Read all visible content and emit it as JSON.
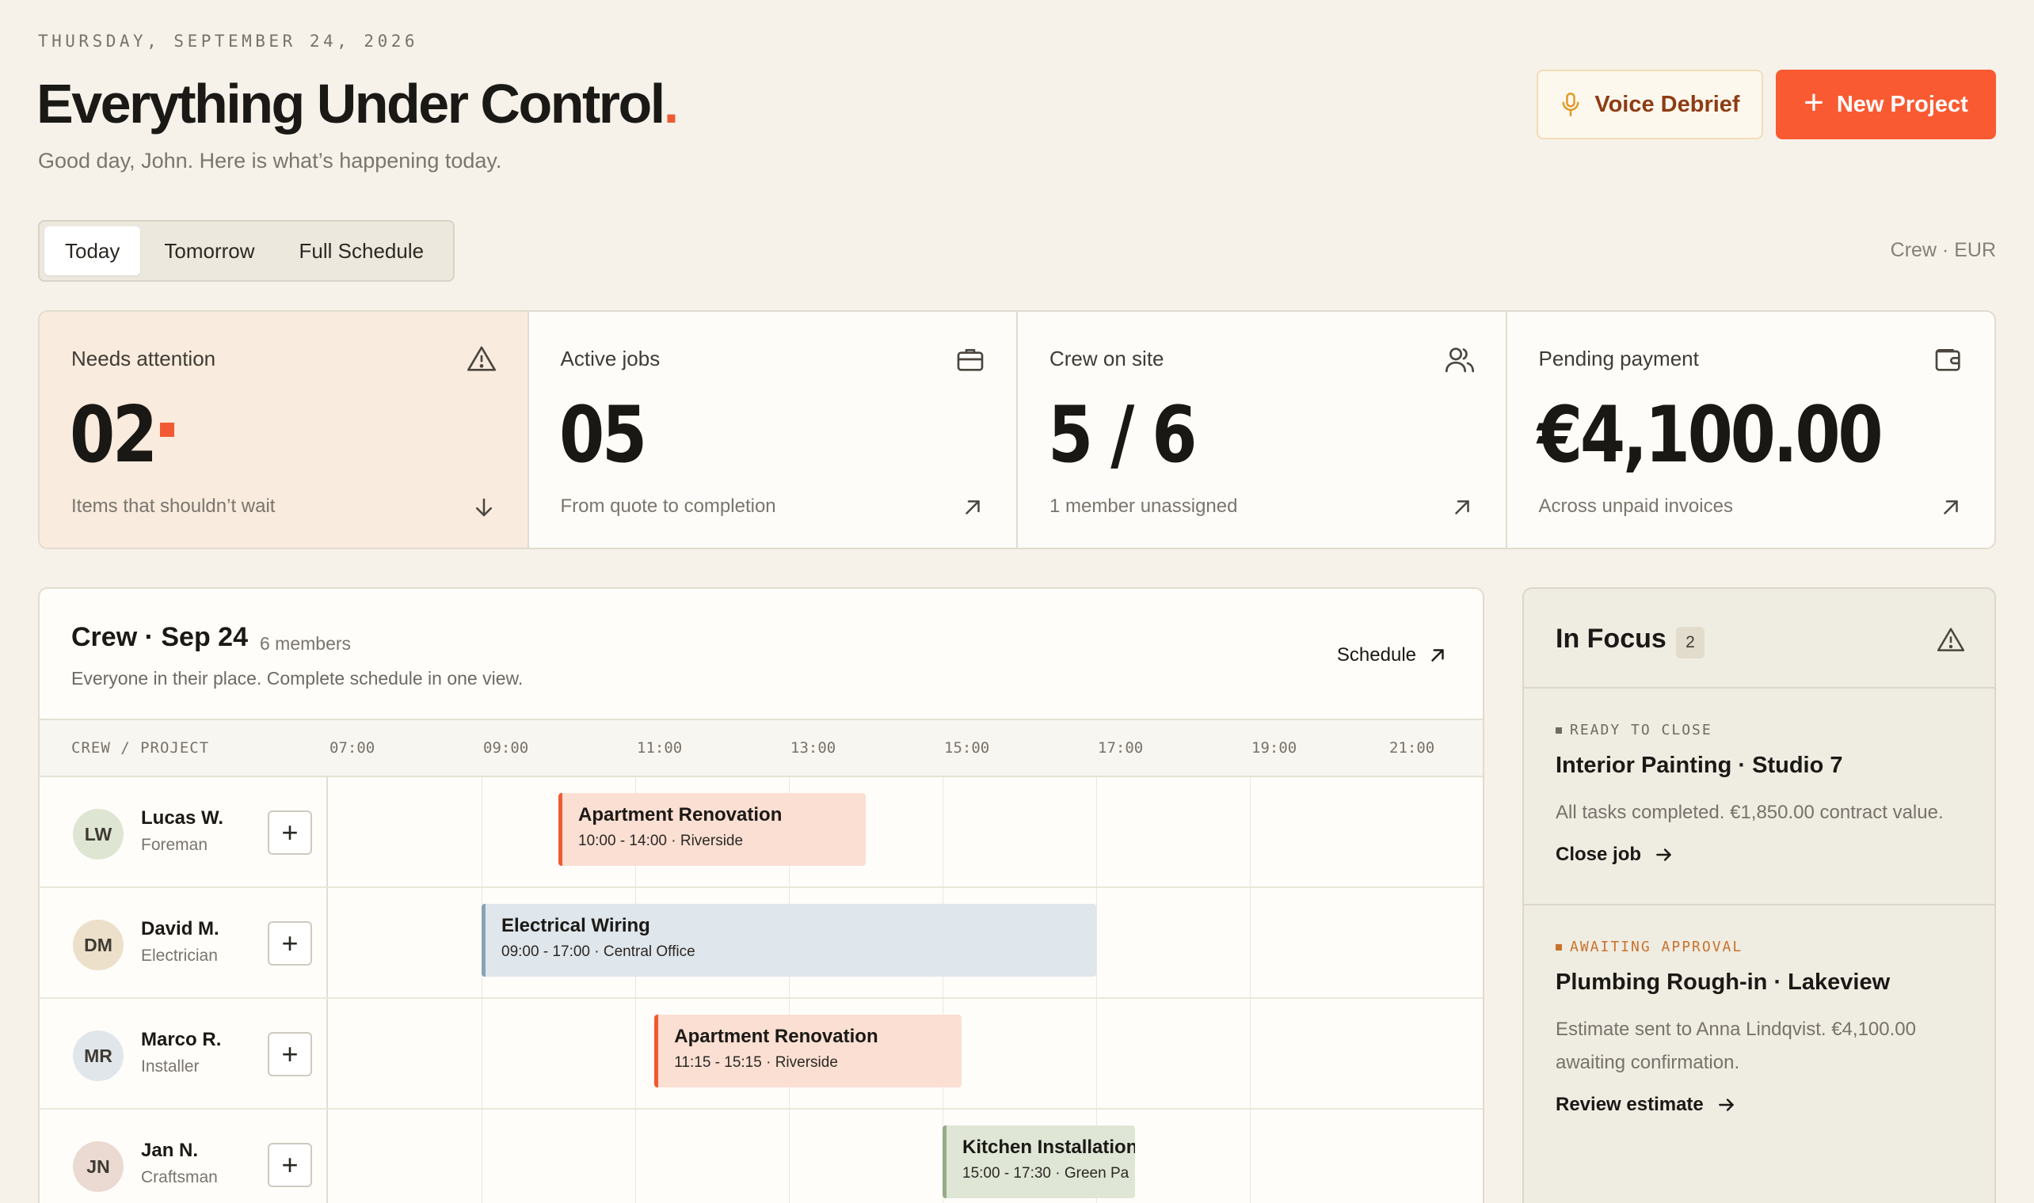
{
  "header": {
    "date": "THURSDAY, SEPTEMBER 24, 2026",
    "title": "Everything Under Control",
    "title_dot": ".",
    "subtitle": "Good day, John. Here is what’s happening today.",
    "voice_label": "Voice Debrief",
    "new_label": "New Project"
  },
  "tabs": [
    {
      "label": "Today",
      "active": true
    },
    {
      "label": "Tomorrow",
      "active": false
    },
    {
      "label": "Full Schedule",
      "active": false
    }
  ],
  "context": "Crew · EUR",
  "stats": [
    {
      "label": "Needs attention",
      "value": "02",
      "desc": "Items that shouldn’t wait",
      "icon": "warning-icon"
    },
    {
      "label": "Active jobs",
      "value": "05",
      "desc": "From quote to completion",
      "icon": "briefcase-icon"
    },
    {
      "label": "Crew on site",
      "value": "5 / 6",
      "desc": "1 member unassigned",
      "icon": "users-icon"
    },
    {
      "label": "Pending payment",
      "value": "€4,100.00",
      "desc": "Across unpaid invoices",
      "icon": "wallet-icon"
    }
  ],
  "crew": {
    "title": "Crew · Sep 24",
    "members": "6 members",
    "subtitle": "Everyone in their place. Complete schedule in one view.",
    "schedule_label": "Schedule",
    "column_header": "CREW / PROJECT",
    "hours": [
      "07:00",
      "09:00",
      "11:00",
      "13:00",
      "15:00",
      "17:00",
      "19:00",
      "21:00"
    ],
    "rows": [
      {
        "initials": "LW",
        "name": "Lucas W.",
        "role": "Foreman",
        "avatar_color": "#dfe5d3",
        "job": {
          "title": "Apartment Renovation",
          "sub": "10:00 - 14:00 · Riverside",
          "start": 10.0,
          "end": 14.0,
          "color": "orange"
        }
      },
      {
        "initials": "DM",
        "name": "David M.",
        "role": "Electrician",
        "avatar_color": "#ece0ca",
        "job": {
          "title": "Electrical Wiring",
          "sub": "09:00 - 17:00 · Central Office",
          "start": 9.0,
          "end": 17.0,
          "color": "blue"
        }
      },
      {
        "initials": "MR",
        "name": "Marco R.",
        "role": "Installer",
        "avatar_color": "#e1e6ea",
        "job": {
          "title": "Apartment Renovation",
          "sub": "11:15 - 15:15 · Riverside",
          "start": 11.25,
          "end": 15.25,
          "color": "orange"
        }
      },
      {
        "initials": "JN",
        "name": "Jan N.",
        "role": "Craftsman",
        "avatar_color": "#eadad1",
        "job": {
          "title": "Kitchen Installation",
          "sub": "15:00 - 17:30 · Green Pa",
          "start": 15.0,
          "end": 17.5,
          "color": "green"
        }
      }
    ]
  },
  "focus": {
    "title": "In Focus",
    "count": "2",
    "items": [
      {
        "tag": "READY TO CLOSE",
        "tag_color": "#6f6a62",
        "title": "Interior Painting · Studio 7",
        "desc": "All tasks completed. €1,850.00 contract value.",
        "link": "Close job"
      },
      {
        "tag": "AWAITING APPROVAL",
        "tag_color": "#c8722c",
        "title": "Plumbing Rough-in · Lakeview",
        "desc": "Estimate sent to Anna Lindqvist. €4,100.00 awaiting confirmation.",
        "link": "Review estimate"
      }
    ]
  },
  "colors": {
    "accent": "#fa5a31",
    "background": "#f6f2ea"
  }
}
